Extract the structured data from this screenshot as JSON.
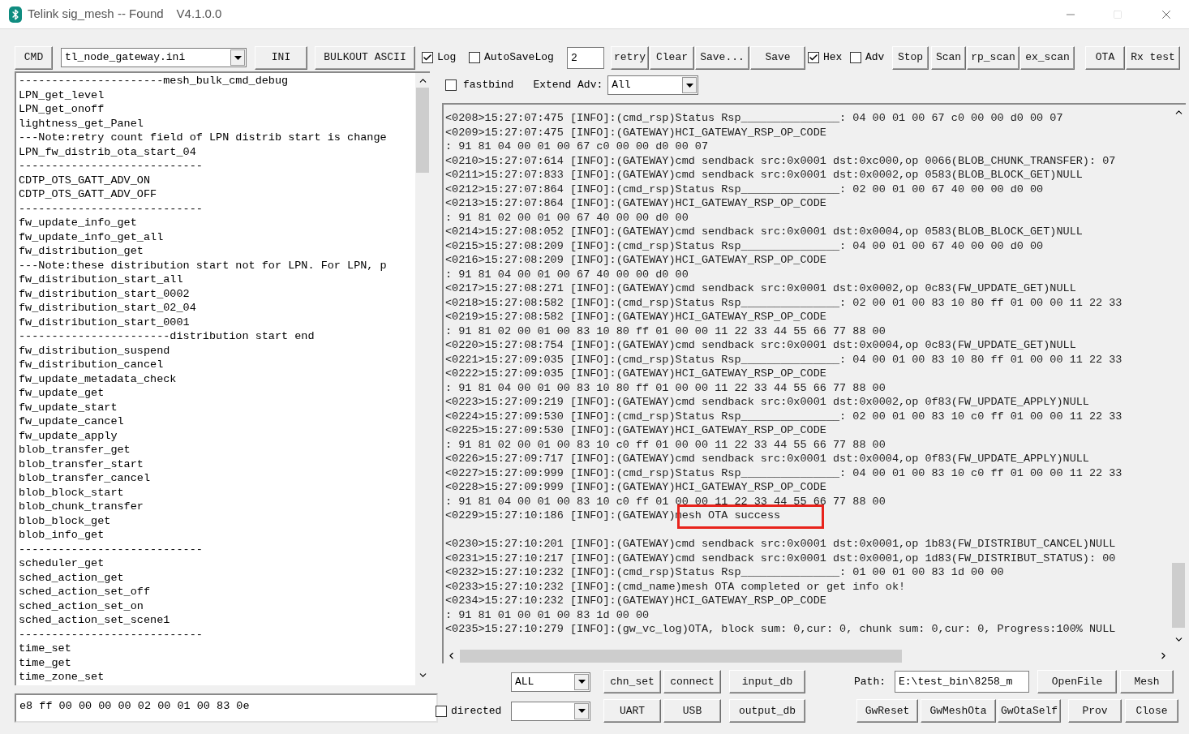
{
  "window": {
    "title": "Telink sig_mesh -- Found",
    "version": "V4.1.0.0"
  },
  "toolbar": [
    {
      "kind": "button",
      "label": "CMD"
    },
    {
      "kind": "select",
      "value": "tl_node_gateway.ini"
    },
    {
      "kind": "button",
      "label": "INI"
    },
    {
      "kind": "button",
      "label": "BULKOUT ASCII"
    },
    {
      "kind": "checkbox",
      "label": "Log",
      "checked": true
    },
    {
      "kind": "checkbox",
      "label": "AutoSaveLog",
      "checked": false
    },
    {
      "kind": "field",
      "value": "2"
    },
    {
      "kind": "button",
      "label": "retry"
    },
    {
      "kind": "button",
      "label": "Clear"
    },
    {
      "kind": "button",
      "label": "Save..."
    },
    {
      "kind": "button",
      "label": "Save"
    },
    {
      "kind": "checkbox",
      "label": "Hex",
      "checked": true
    },
    {
      "kind": "checkbox",
      "label": "Adv",
      "checked": false
    },
    {
      "kind": "button",
      "label": "Stop"
    },
    {
      "kind": "button",
      "label": "Scan"
    },
    {
      "kind": "button",
      "label": "rp_scan"
    },
    {
      "kind": "button",
      "label": "ex_scan"
    },
    {
      "kind": "button",
      "label": "OTA"
    },
    {
      "kind": "button",
      "label": "Rx test"
    }
  ],
  "options": {
    "fastbind": {
      "label": "fastbind",
      "checked": false
    },
    "extend_adv": {
      "label": "Extend Adv:",
      "value": "All"
    }
  },
  "command_list": [
    "----------------------mesh_bulk_cmd_debug",
    "LPN_get_level",
    "LPN_get_onoff",
    "lightness_get_Panel",
    "---Note:retry count field of LPN distrib start is change",
    "LPN_fw_distrib_ota_start_04",
    "----------------------------",
    "CDTP_OTS_GATT_ADV_ON",
    "CDTP_OTS_GATT_ADV_OFF",
    "----------------------------",
    "fw_update_info_get",
    "fw_update_info_get_all",
    "fw_distribution_get",
    "---Note:these distribution start not for LPN. For LPN, p",
    "fw_distribution_start_all",
    "fw_distribution_start_0002",
    "fw_distribution_start_02_04",
    "fw_distribution_start_0001",
    "-----------------------distribution start end",
    "fw_distribution_suspend",
    "fw_distribution_cancel",
    "fw_update_metadata_check",
    "fw_update_get",
    "fw_update_start",
    "fw_update_cancel",
    "fw_update_apply",
    "blob_transfer_get",
    "blob_transfer_start",
    "blob_transfer_cancel",
    "blob_block_start",
    "blob_chunk_transfer",
    "blob_block_get",
    "blob_info_get",
    "----------------------------",
    "scheduler_get",
    "sched_action_get",
    "sched_action_set_off",
    "sched_action_set_on",
    "sched_action_set_scene1",
    "----------------------------",
    "time_set",
    "time_get",
    "time_zone_set"
  ],
  "command_input": {
    "value": "e8 ff 00 00 00 00 02 00 01 00 83 0e"
  },
  "log": [
    {
      "kind": "entry",
      "text": "<0208>15:27:07:475 [INFO]:(cmd_rsp)Status Rsp_______________: 04 00 01 00 67 c0 00 00 d0 00 07",
      "highlighted": false
    },
    {
      "kind": "entry",
      "text": "<0209>15:27:07:475 [INFO]:(GATEWAY)HCI_GATEWAY_RSP_OP_CODE",
      "highlighted": false
    },
    {
      "kind": "entry",
      "text": ": 91 81 04 00 01 00 67 c0 00 00 d0 00 07",
      "highlighted": false
    },
    {
      "kind": "entry",
      "text": "<0210>15:27:07:614 [INFO]:(GATEWAY)cmd sendback src:0x0001 dst:0xc000,op 0066(BLOB_CHUNK_TRANSFER): 07",
      "highlighted": false
    },
    {
      "kind": "entry",
      "text": "<0211>15:27:07:833 [INFO]:(GATEWAY)cmd sendback src:0x0001 dst:0x0002,op 0583(BLOB_BLOCK_GET)NULL",
      "highlighted": false
    },
    {
      "kind": "entry",
      "text": "<0212>15:27:07:864 [INFO]:(cmd_rsp)Status Rsp_______________: 02 00 01 00 67 40 00 00 d0 00",
      "highlighted": false
    },
    {
      "kind": "entry",
      "text": "<0213>15:27:07:864 [INFO]:(GATEWAY)HCI_GATEWAY_RSP_OP_CODE",
      "highlighted": false
    },
    {
      "kind": "entry",
      "text": ": 91 81 02 00 01 00 67 40 00 00 d0 00",
      "highlighted": false
    },
    {
      "kind": "entry",
      "text": "<0214>15:27:08:052 [INFO]:(GATEWAY)cmd sendback src:0x0001 dst:0x0004,op 0583(BLOB_BLOCK_GET)NULL",
      "highlighted": false
    },
    {
      "kind": "entry",
      "text": "<0215>15:27:08:209 [INFO]:(cmd_rsp)Status Rsp_______________: 04 00 01 00 67 40 00 00 d0 00",
      "highlighted": false
    },
    {
      "kind": "entry",
      "text": "<0216>15:27:08:209 [INFO]:(GATEWAY)HCI_GATEWAY_RSP_OP_CODE",
      "highlighted": false
    },
    {
      "kind": "entry",
      "text": ": 91 81 04 00 01 00 67 40 00 00 d0 00",
      "highlighted": false
    },
    {
      "kind": "entry",
      "text": "<0217>15:27:08:271 [INFO]:(GATEWAY)cmd sendback src:0x0001 dst:0x0002,op 0c83(FW_UPDATE_GET)NULL",
      "highlighted": false
    },
    {
      "kind": "entry",
      "text": "<0218>15:27:08:582 [INFO]:(cmd_rsp)Status Rsp_______________: 02 00 01 00 83 10 80 ff 01 00 00 11 22 33",
      "highlighted": false
    },
    {
      "kind": "entry",
      "text": "<0219>15:27:08:582 [INFO]:(GATEWAY)HCI_GATEWAY_RSP_OP_CODE",
      "highlighted": false
    },
    {
      "kind": "entry",
      "text": ": 91 81 02 00 01 00 83 10 80 ff 01 00 00 11 22 33 44 55 66 77 88 00",
      "highlighted": false
    },
    {
      "kind": "entry",
      "text": "<0220>15:27:08:754 [INFO]:(GATEWAY)cmd sendback src:0x0001 dst:0x0004,op 0c83(FW_UPDATE_GET)NULL",
      "highlighted": false
    },
    {
      "kind": "entry",
      "text": "<0221>15:27:09:035 [INFO]:(cmd_rsp)Status Rsp_______________: 04 00 01 00 83 10 80 ff 01 00 00 11 22 33",
      "highlighted": false
    },
    {
      "kind": "entry",
      "text": "<0222>15:27:09:035 [INFO]:(GATEWAY)HCI_GATEWAY_RSP_OP_CODE",
      "highlighted": false
    },
    {
      "kind": "entry",
      "text": ": 91 81 04 00 01 00 83 10 80 ff 01 00 00 11 22 33 44 55 66 77 88 00",
      "highlighted": false
    },
    {
      "kind": "entry",
      "text": "<0223>15:27:09:219 [INFO]:(GATEWAY)cmd sendback src:0x0001 dst:0x0002,op 0f83(FW_UPDATE_APPLY)NULL",
      "highlighted": false
    },
    {
      "kind": "entry",
      "text": "<0224>15:27:09:530 [INFO]:(cmd_rsp)Status Rsp_______________: 02 00 01 00 83 10 c0 ff 01 00 00 11 22 33",
      "highlighted": false
    },
    {
      "kind": "entry",
      "text": "<0225>15:27:09:530 [INFO]:(GATEWAY)HCI_GATEWAY_RSP_OP_CODE",
      "highlighted": false
    },
    {
      "kind": "entry",
      "text": ": 91 81 02 00 01 00 83 10 c0 ff 01 00 00 11 22 33 44 55 66 77 88 00",
      "highlighted": false
    },
    {
      "kind": "entry",
      "text": "<0226>15:27:09:717 [INFO]:(GATEWAY)cmd sendback src:0x0001 dst:0x0004,op 0f83(FW_UPDATE_APPLY)NULL",
      "highlighted": false
    },
    {
      "kind": "entry",
      "text": "<0227>15:27:09:999 [INFO]:(cmd_rsp)Status Rsp_______________: 04 00 01 00 83 10 c0 ff 01 00 00 11 22 33",
      "highlighted": false
    },
    {
      "kind": "entry",
      "text": "<0228>15:27:09:999 [INFO]:(GATEWAY)HCI_GATEWAY_RSP_OP_CODE",
      "highlighted": false
    },
    {
      "kind": "entry",
      "text": ": 91 81 04 00 01 00 83 10 c0 ff 01 00 00 11 22 33 44 55 66 77 88 00",
      "highlighted": false
    },
    {
      "kind": "entry",
      "text": "<0229>15:27:10:186 [INFO]:(GATEWAY)mesh OTA success",
      "highlighted": true
    },
    {
      "kind": "blank"
    },
    {
      "kind": "entry",
      "text": "<0230>15:27:10:201 [INFO]:(GATEWAY)cmd sendback src:0x0001 dst:0x0001,op 1b83(FW_DISTRIBUT_CANCEL)NULL",
      "highlighted": false
    },
    {
      "kind": "entry",
      "text": "<0231>15:27:10:217 [INFO]:(GATEWAY)cmd sendback src:0x0001 dst:0x0001,op 1d83(FW_DISTRIBUT_STATUS): 00",
      "highlighted": false
    },
    {
      "kind": "entry",
      "text": "<0232>15:27:10:232 [INFO]:(cmd_rsp)Status Rsp_______________: 01 00 01 00 83 1d 00 00",
      "highlighted": false
    },
    {
      "kind": "entry",
      "text": "<0233>15:27:10:232 [INFO]:(cmd_name)mesh OTA completed or get info ok!",
      "highlighted": false
    },
    {
      "kind": "entry",
      "text": "<0234>15:27:10:232 [INFO]:(GATEWAY)HCI_GATEWAY_RSP_OP_CODE",
      "highlighted": false
    },
    {
      "kind": "entry",
      "text": ": 91 81 01 00 01 00 83 1d 00 00",
      "highlighted": false
    },
    {
      "kind": "entry",
      "text": "<0235>15:27:10:279 [INFO]:(gw_vc_log)OTA, block sum: 0,cur: 0, chunk sum: 0,cur: 0, Progress:100% NULL",
      "highlighted": false
    }
  ],
  "bottom_rows": [
    [
      {
        "kind": "select",
        "value": "ALL"
      },
      {
        "kind": "button",
        "label": "chn_set"
      },
      {
        "kind": "button",
        "label": "connect"
      },
      {
        "kind": "button",
        "label": "input_db"
      },
      {
        "kind": "label",
        "text": "Path:"
      },
      {
        "kind": "field",
        "value": "E:\\test_bin\\8258_m"
      },
      {
        "kind": "button",
        "label": "OpenFile"
      },
      {
        "kind": "button",
        "label": "Mesh"
      }
    ],
    [
      {
        "kind": "checkbox",
        "label": "directed",
        "checked": false
      },
      {
        "kind": "select"
      },
      {
        "kind": "button",
        "label": "UART"
      },
      {
        "kind": "button",
        "label": "USB"
      },
      {
        "kind": "button",
        "label": "output_db"
      },
      {
        "kind": "button",
        "label": "GwReset"
      },
      {
        "kind": "button",
        "label": "GwMeshOta"
      },
      {
        "kind": "button",
        "label": "GwOtaSelf"
      },
      {
        "kind": "button",
        "label": "Prov"
      },
      {
        "kind": "button",
        "label": "Close"
      }
    ]
  ]
}
